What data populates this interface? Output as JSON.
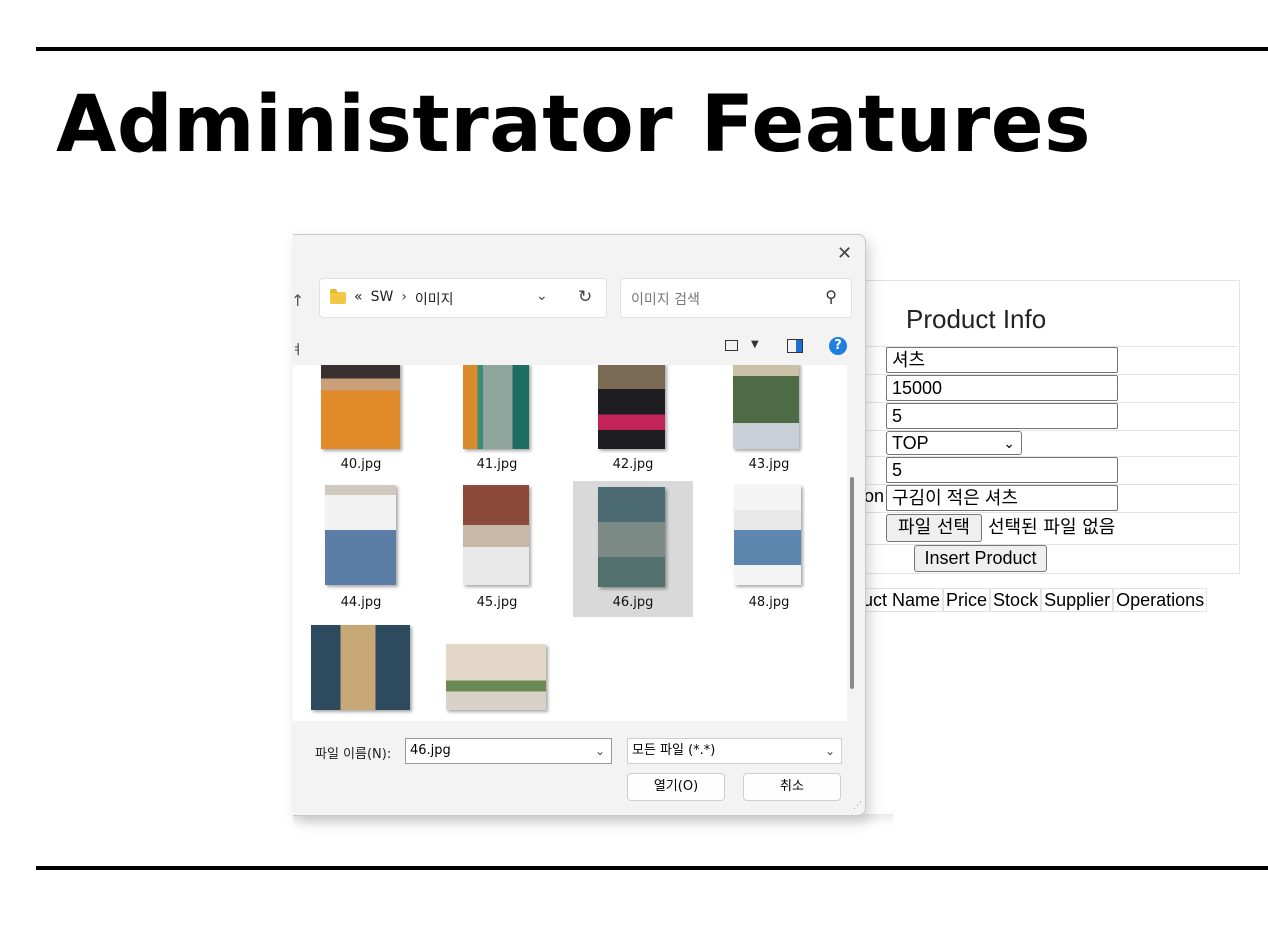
{
  "slide": {
    "title": "Administrator Features"
  },
  "form": {
    "heading": "Product Info",
    "name_value": "셔츠",
    "price_value": "15000",
    "stock_value": "5",
    "category_value": "TOP",
    "supplier_value": "5",
    "description_label_fragment": "on",
    "description_value": "구김이 적은 셔츠",
    "file_button": "파일 선택",
    "file_status": "선택된 파일 없음",
    "insert_button": "Insert Product",
    "table_headers": [
      "uct Name",
      "Price",
      "Stock",
      "Supplier",
      "Operations"
    ]
  },
  "dialog": {
    "close_glyph": "✕",
    "up_glyph": "↑",
    "breadcrumb_overflow": "«",
    "breadcrumb": [
      "SW",
      "이미지"
    ],
    "breadcrumb_sep": "›",
    "search_placeholder": "이미지 검색",
    "toolbar_fragment": "ㅕ",
    "help_glyph": "?",
    "files": [
      "40.jpg",
      "41.jpg",
      "42.jpg",
      "43.jpg",
      "44.jpg",
      "45.jpg",
      "46.jpg",
      "48.jpg"
    ],
    "selected_file": "46.jpg",
    "filename_label": "파일 이름(N):",
    "filename_value": "46.jpg",
    "filetype_value": "모든 파일 (*.*)",
    "open_button": "열기(O)",
    "cancel_button": "취소"
  }
}
